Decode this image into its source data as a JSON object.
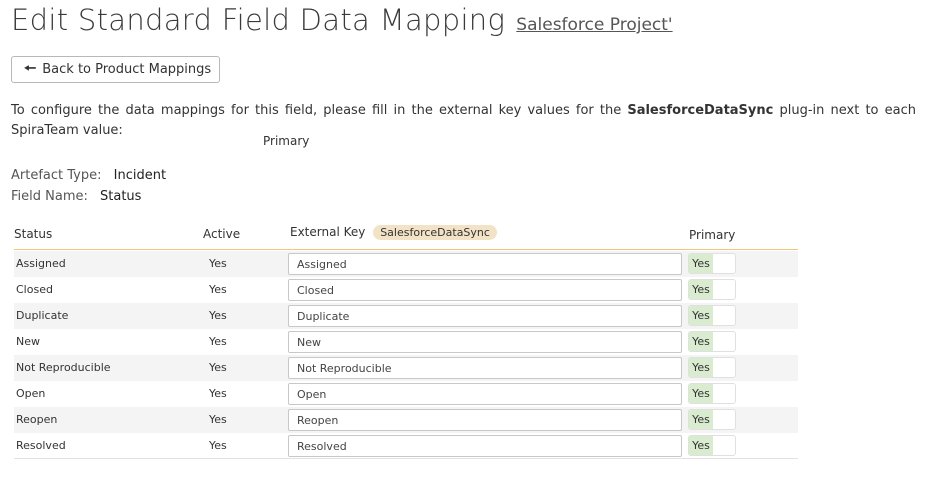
{
  "header": {
    "title": "Edit Standard Field Data Mapping",
    "project_link": "Salesforce Project'"
  },
  "back_button": {
    "label": "Back to Product Mappings"
  },
  "intro": {
    "text_before": "To configure the data mappings for this field, please fill in the external key values for the ",
    "plugin": "SalesforceDataSync",
    "text_after": " plug-in next to each SpiraTeam value:"
  },
  "primary_hint": "Primary",
  "meta": {
    "artefact_type_label": "Artefact Type:",
    "artefact_type_value": "Incident",
    "field_name_label": "Field Name:",
    "field_name_value": "Status"
  },
  "table": {
    "headers": {
      "status": "Status",
      "active": "Active",
      "external_key": "External Key",
      "external_key_badge": "SalesforceDataSync",
      "primary": "Primary"
    },
    "rows": [
      {
        "status": "Assigned",
        "active": "Yes",
        "external_key": "Assigned",
        "primary": "Yes"
      },
      {
        "status": "Closed",
        "active": "Yes",
        "external_key": "Closed",
        "primary": "Yes"
      },
      {
        "status": "Duplicate",
        "active": "Yes",
        "external_key": "Duplicate",
        "primary": "Yes"
      },
      {
        "status": "New",
        "active": "Yes",
        "external_key": "New",
        "primary": "Yes"
      },
      {
        "status": "Not Reproducible",
        "active": "Yes",
        "external_key": "Not Reproducible",
        "primary": "Yes"
      },
      {
        "status": "Open",
        "active": "Yes",
        "external_key": "Open",
        "primary": "Yes"
      },
      {
        "status": "Reopen",
        "active": "Yes",
        "external_key": "Reopen",
        "primary": "Yes"
      },
      {
        "status": "Resolved",
        "active": "Yes",
        "external_key": "Resolved",
        "primary": "Yes"
      }
    ]
  },
  "icons": {
    "back": "arrow-left-icon"
  },
  "colors": {
    "header_rule": "#f0c67a",
    "badge_bg": "#f3e3c6",
    "toggle_on": "#d9ecd0",
    "row_alt": "#f4f4f4"
  }
}
